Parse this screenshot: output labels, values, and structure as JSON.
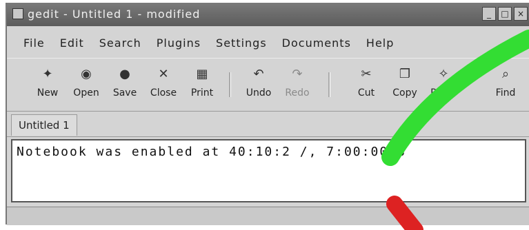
{
  "window": {
    "title": "gedit - Untitled 1 - modified",
    "buttons": [
      "_",
      "□",
      "×"
    ]
  },
  "menubar": {
    "items": [
      "File",
      "Edit",
      "Search",
      "Plugins",
      "Settings",
      "Documents",
      "Help"
    ]
  },
  "toolbar": {
    "items": [
      {
        "label": "New",
        "icon": "new-icon"
      },
      {
        "label": "Open",
        "icon": "open-icon"
      },
      {
        "label": "Save",
        "icon": "save-icon"
      },
      {
        "label": "Close",
        "icon": "close-icon"
      },
      {
        "label": "Print",
        "icon": "print-icon"
      },
      {
        "label": "Undo",
        "icon": "undo-icon"
      },
      {
        "label": "Redo",
        "icon": "redo-icon"
      },
      {
        "label": "Cut",
        "icon": "cut-icon"
      },
      {
        "label": "Copy",
        "icon": "copy-icon"
      },
      {
        "label": "Paste",
        "icon": "paste-icon"
      },
      {
        "label": "Find",
        "icon": "find-icon"
      }
    ]
  },
  "tabs": [
    {
      "label": "Untitled 1"
    }
  ],
  "editor": {
    "content": "Notebook was enabled at 40:10:2 /, 7:00:00 8"
  },
  "overlay": {
    "stroke_green": "#33dd33",
    "stroke_red": "#dd2222"
  }
}
